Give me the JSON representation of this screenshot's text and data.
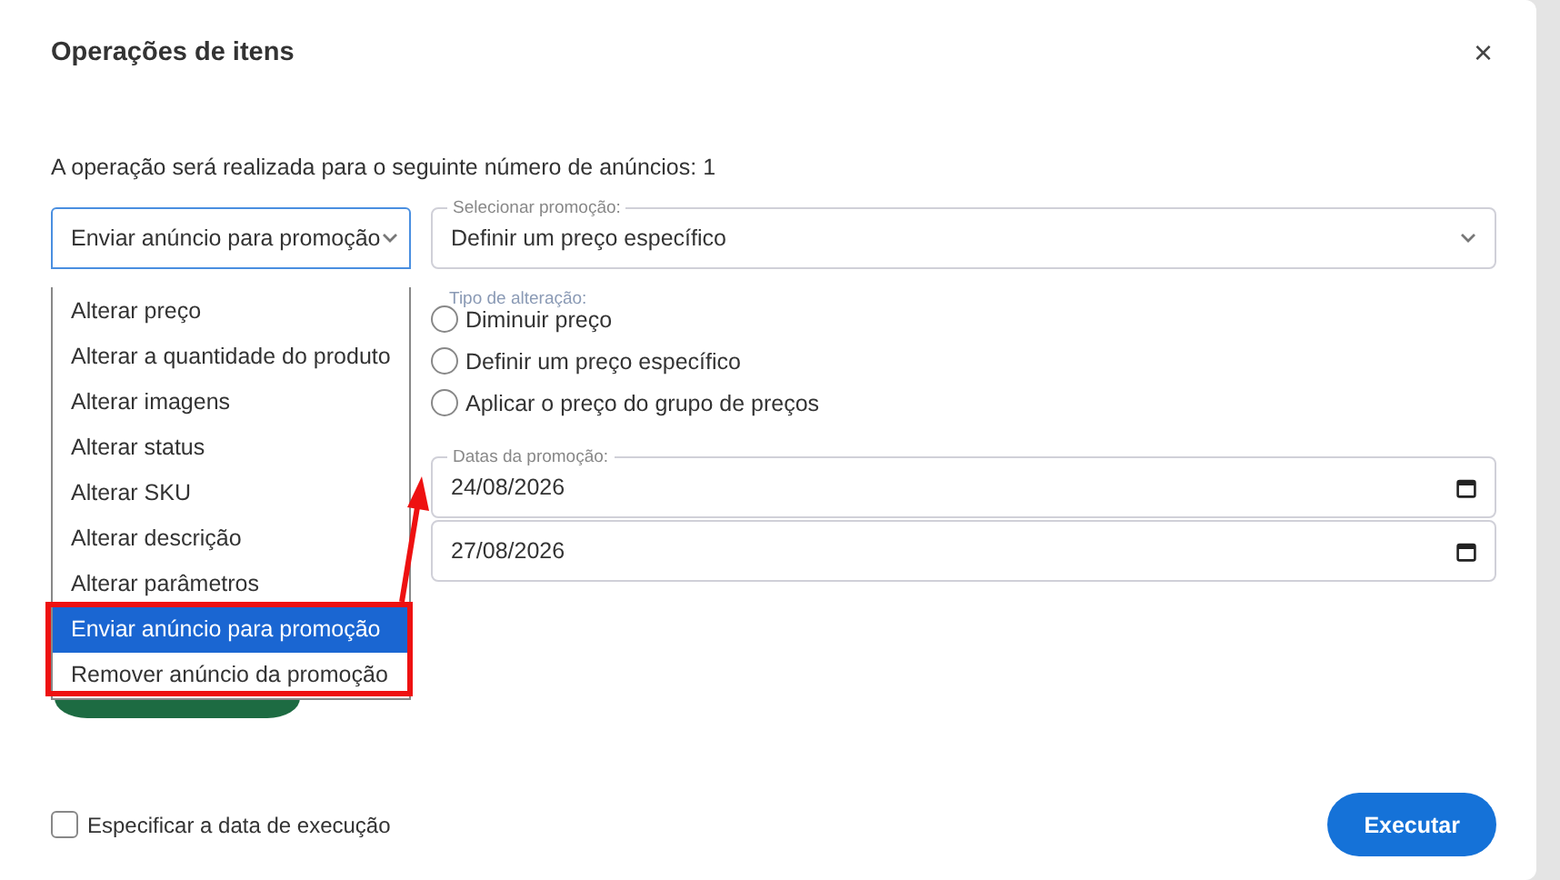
{
  "dialog": {
    "title": "Operações de itens",
    "close": "×",
    "info": "A operação será realizada para o seguinte número de anúncios: 1"
  },
  "operation_select": {
    "value": "Enviar anúncio para promoção",
    "expanded": true
  },
  "operation_options": [
    {
      "label": "Alterar preço",
      "selected": false
    },
    {
      "label": "Alterar a quantidade do produto",
      "selected": false
    },
    {
      "label": "Alterar imagens",
      "selected": false
    },
    {
      "label": "Alterar status",
      "selected": false
    },
    {
      "label": "Alterar SKU",
      "selected": false
    },
    {
      "label": "Alterar descrição",
      "selected": false
    },
    {
      "label": "Alterar parâmetros",
      "selected": false
    },
    {
      "label": "Enviar anúncio para promoção",
      "selected": true
    },
    {
      "label": "Remover anúncio da promoção",
      "selected": false
    }
  ],
  "promotion_select": {
    "label": "Selecionar promoção:",
    "value": "Definir um preço específico"
  },
  "change_type": {
    "label": "Tipo de alteração:",
    "options": [
      {
        "label": "Diminuir preço",
        "selected": false
      },
      {
        "label": "Definir um preço específico",
        "selected": false
      },
      {
        "label": "Aplicar o preço do grupo de preços",
        "selected": false
      }
    ]
  },
  "promotion_dates": {
    "label": "Datas da promoção:",
    "values": [
      "24/08/2026",
      "27/08/2026"
    ]
  },
  "schedule_checkbox": {
    "label": "Especificar a data de execução",
    "checked": false
  },
  "execute_button": "Executar"
}
